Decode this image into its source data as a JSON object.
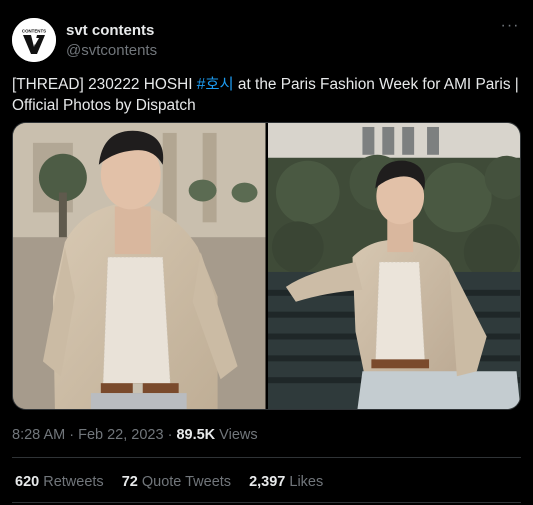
{
  "author": {
    "display_name": "svt contents",
    "handle": "@svtcontents",
    "avatar_logo_text": "CONTENTS"
  },
  "more_icon": "more-horizontal-icon",
  "tweet": {
    "text_before": "[THREAD] 230222 HOSHI ",
    "hashtag": "#호시",
    "text_after": " at the Paris Fashion Week for AMI Paris | Official Photos by Dispatch"
  },
  "meta": {
    "time": "8:28 AM",
    "separator1": " · ",
    "date": "Feb 22, 2023",
    "separator2": " · ",
    "views_count": "89.5K",
    "views_label": " Views"
  },
  "stats": {
    "retweets_count": "620",
    "retweets_label": " Retweets",
    "quotes_count": "72",
    "quotes_label": " Quote Tweets",
    "likes_count": "2,397",
    "likes_label": " Likes"
  },
  "colors": {
    "background": "#000000",
    "text": "#e7e9ea",
    "secondary": "#71767b",
    "link": "#1d9bf0",
    "border": "#2f3336"
  }
}
